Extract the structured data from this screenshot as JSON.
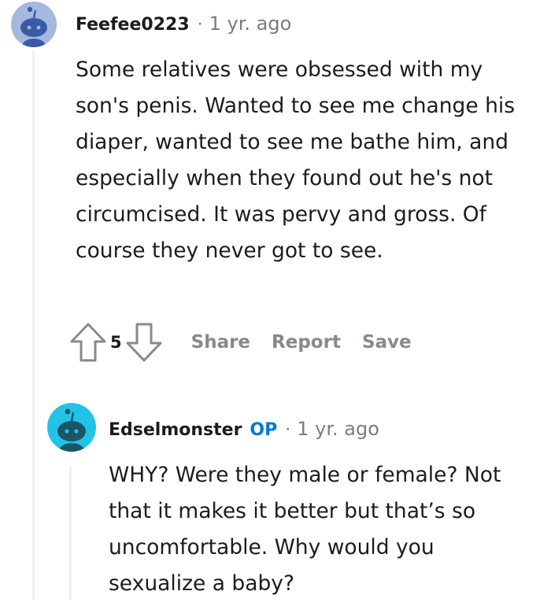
{
  "comments": [
    {
      "username": "Feefee0223",
      "timestamp": "1 yr. ago",
      "body": "Some relatives were obsessed with my son's penis. Wanted to see me change his diaper, wanted to see me bathe him, and especially when they found out he's not circumcised. It was pervy and gross. Of course they never got to see.",
      "score": "5",
      "actions": {
        "share": "Share",
        "report": "Report",
        "save": "Save"
      },
      "avatar_color": "#a5b8e0"
    },
    {
      "username": "Edselmonster",
      "badge": "OP",
      "timestamp": "1 yr. ago",
      "body": "WHY? Were they male or female? Not that it makes it better but that’s so uncomfortable. Why would you sexualize a baby?",
      "avatar_color": "#24c2e6"
    }
  ],
  "colors": {
    "op_badge": "#0079d3",
    "action_gray": "#878a8c",
    "thread_line": "#edeff1"
  },
  "icons": [
    "snoo-avatar-icon",
    "upvote-arrow-icon",
    "downvote-arrow-icon"
  ]
}
